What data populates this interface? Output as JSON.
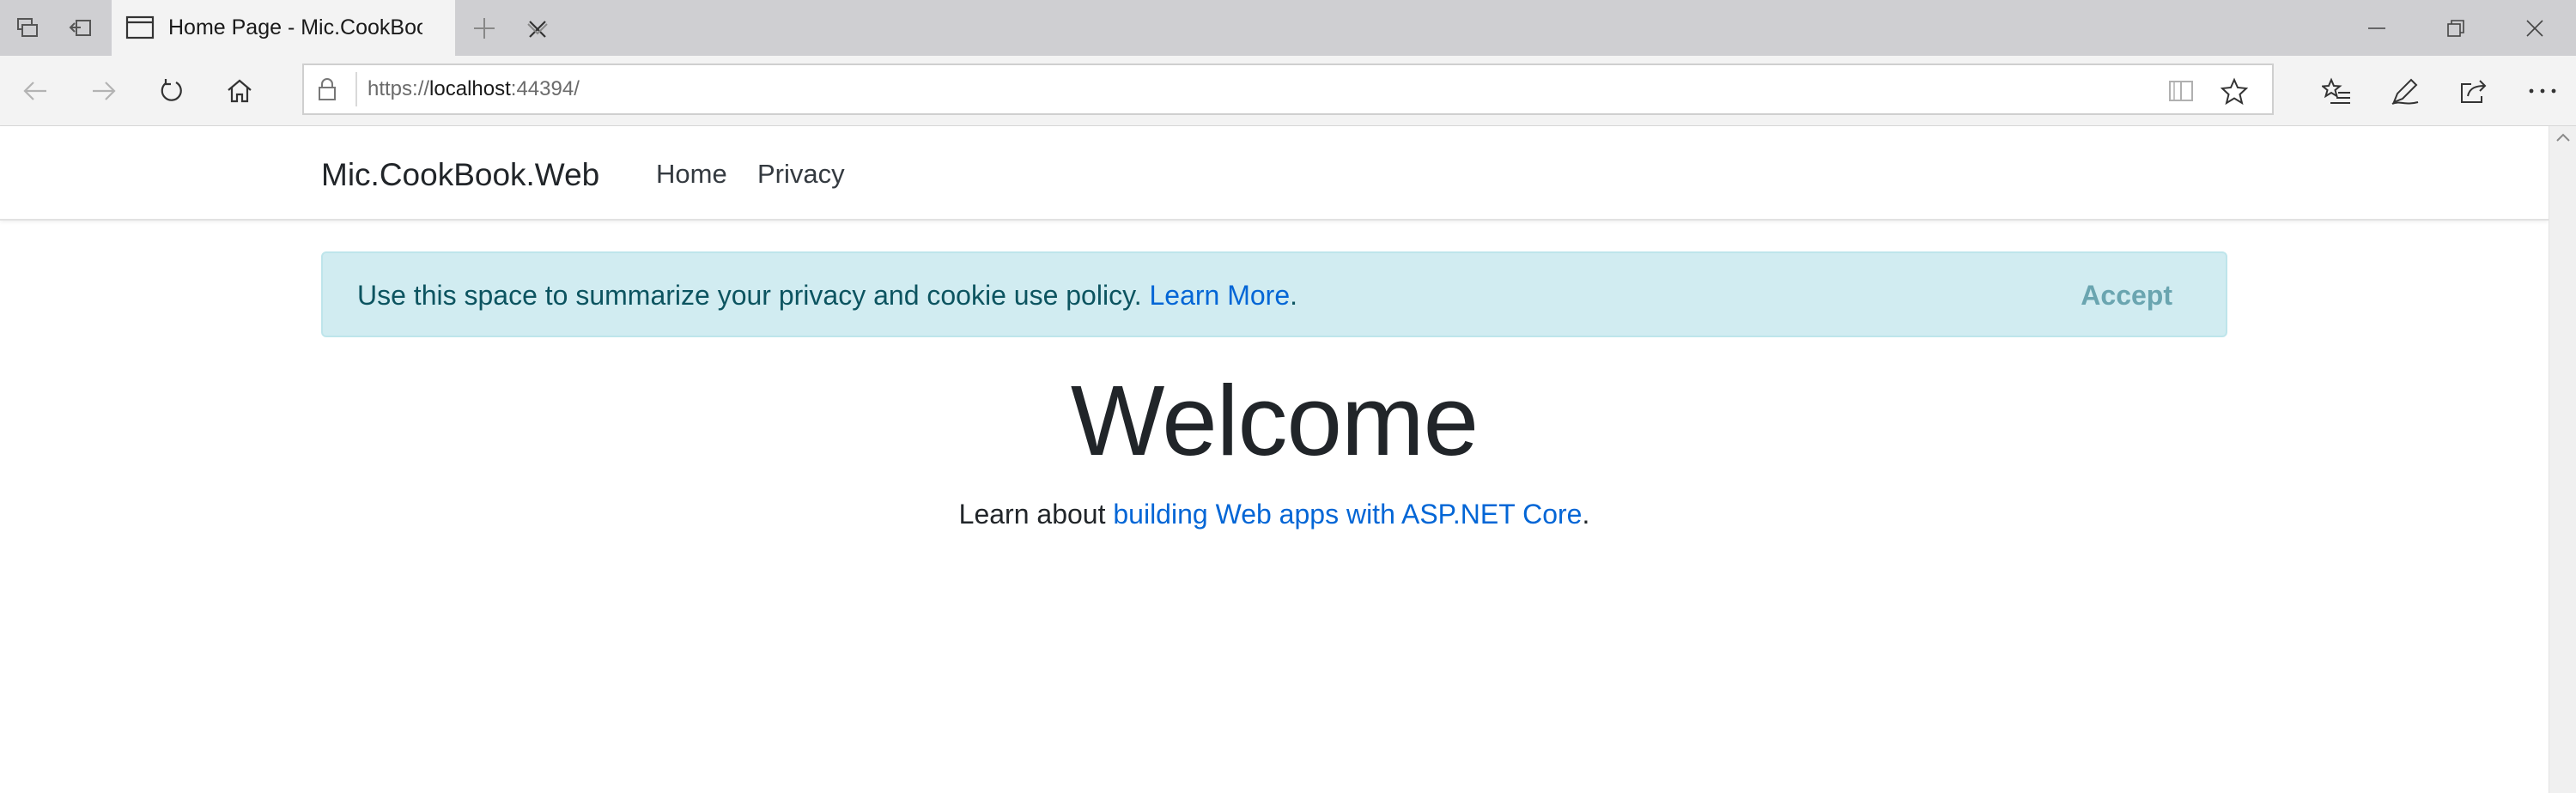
{
  "browser": {
    "tab": {
      "title": "Home Page - Mic.CookBook.Web"
    },
    "address_bar": {
      "scheme": "https://",
      "host": "localhost",
      "port": ":44394/"
    },
    "icons": {
      "tab_strip": [
        "tab-list-icon",
        "set-aside-tabs-icon",
        "new-tab-icon",
        "tab-preview-chevron-icon"
      ],
      "window_controls": [
        "minimize-icon",
        "restore-icon",
        "close-icon"
      ],
      "navigation": [
        "back-icon",
        "forward-icon",
        "refresh-icon",
        "home-icon"
      ],
      "address_bar": [
        "lock-icon",
        "reading-view-icon",
        "favorite-star-icon"
      ],
      "toolbar": [
        "favorites-hub-icon",
        "add-notes-icon",
        "share-icon",
        "settings-more-icon"
      ]
    }
  },
  "site": {
    "brand": "Mic.CookBook.Web",
    "nav": [
      {
        "label": "Home"
      },
      {
        "label": "Privacy"
      }
    ]
  },
  "cookie_consent": {
    "text": "Use this space to summarize your privacy and cookie use policy.",
    "link": "Learn More",
    "suffix": ".",
    "accept": "Accept"
  },
  "main": {
    "heading": "Welcome",
    "intro_prefix": "Learn about",
    "intro_link": "building Web apps with ASP.NET Core",
    "intro_suffix": "."
  },
  "colors": {
    "alert_background": "#d1ecf1",
    "alert_text": "#0c5460",
    "link": "#0366d6",
    "tab_strip": "#cfcfd2"
  }
}
